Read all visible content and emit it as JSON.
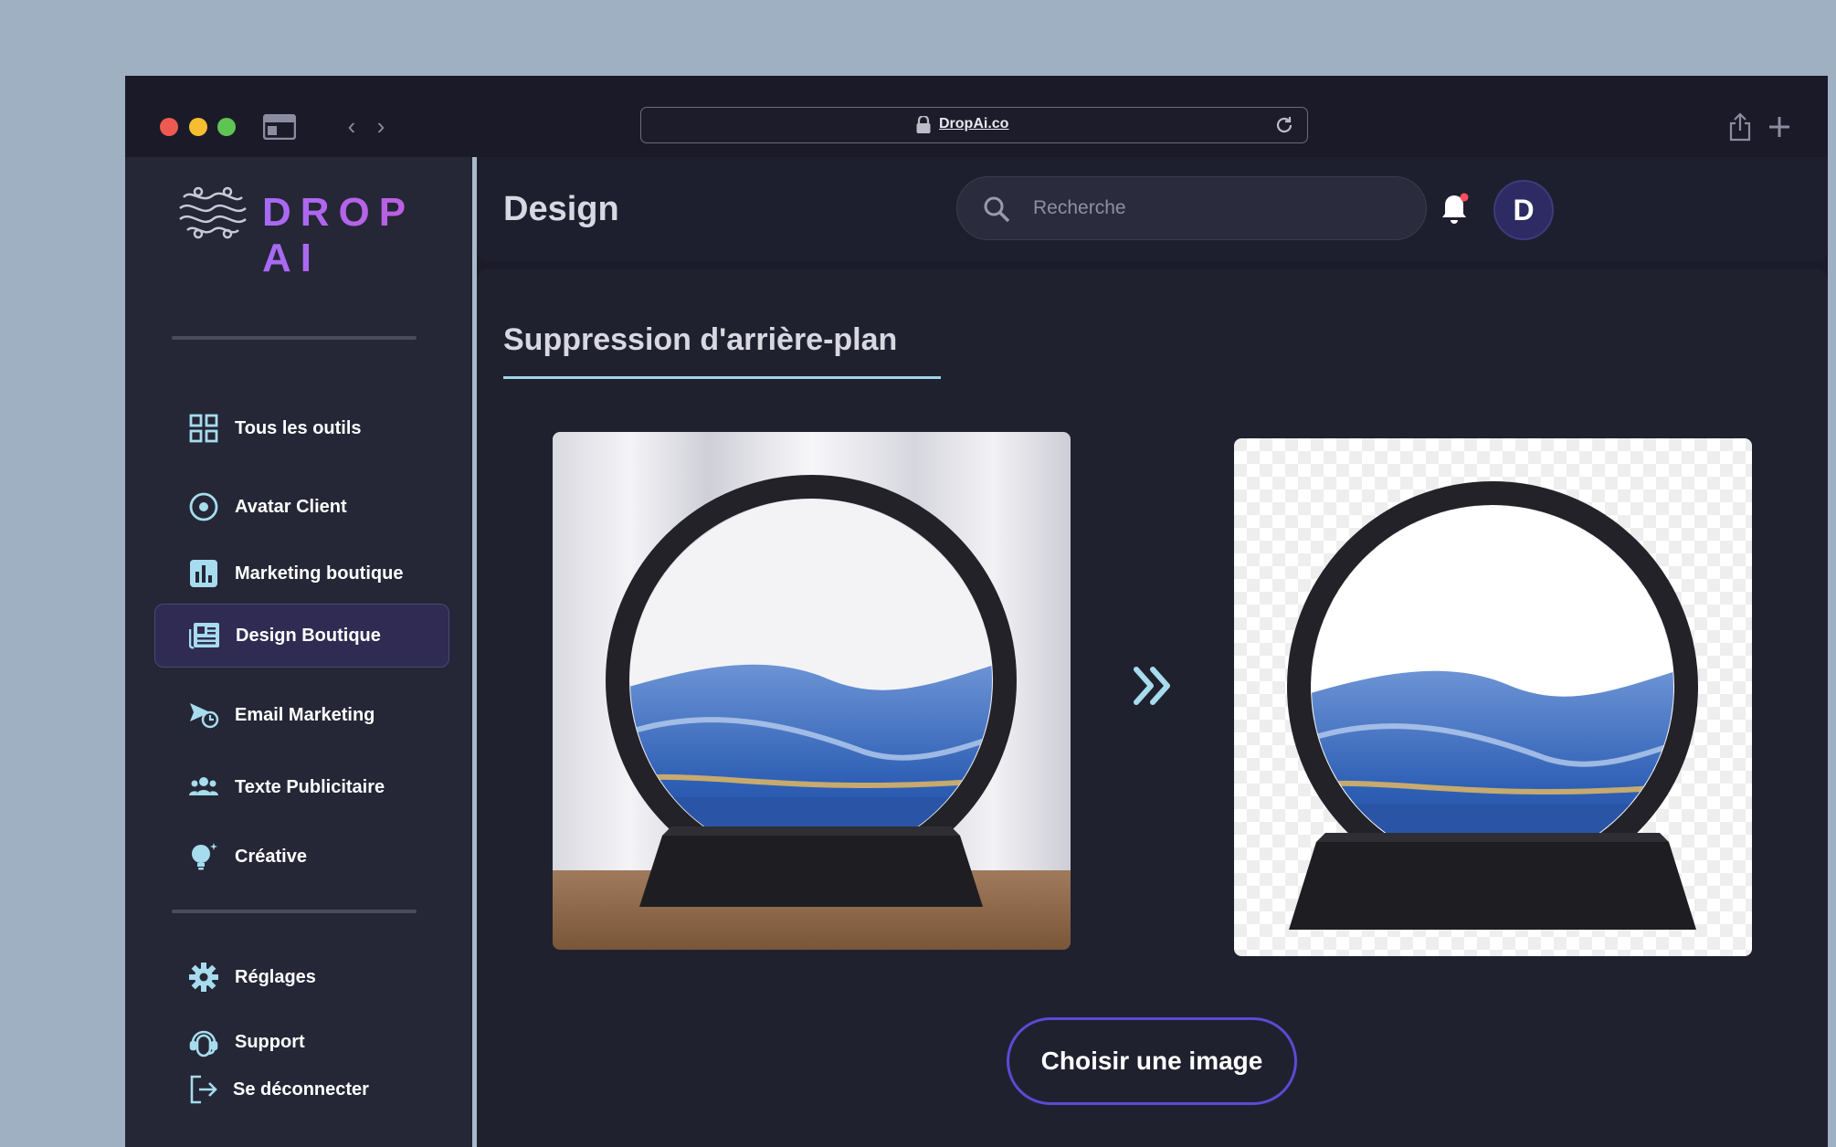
{
  "browser": {
    "url": "DropAi.co"
  },
  "sidebar": {
    "logo_text": "DROP AI",
    "items": [
      {
        "label": "Tous les outils",
        "icon": "grid-icon"
      },
      {
        "label": "Avatar Client",
        "icon": "target-icon"
      },
      {
        "label": "Marketing boutique",
        "icon": "bar-chart-icon"
      },
      {
        "label": "Design Boutique",
        "icon": "newspaper-icon",
        "active": true
      },
      {
        "label": "Email Marketing",
        "icon": "send-clock-icon"
      },
      {
        "label": "Texte Publicitaire",
        "icon": "people-icon"
      },
      {
        "label": "Créative",
        "icon": "lightbulb-icon"
      }
    ],
    "bottom_items": [
      {
        "label": "Réglages",
        "icon": "gear-icon"
      },
      {
        "label": "Support",
        "icon": "support-agent-icon"
      },
      {
        "label": "Se déconnecter",
        "icon": "logout-icon"
      }
    ]
  },
  "header": {
    "title": "Design",
    "search_placeholder": "Recherche",
    "avatar_initial": "D"
  },
  "main": {
    "section_title": "Suppression d'arrière-plan",
    "choose_button": "Choisir une image"
  },
  "colors": {
    "accent": "#9fd5e8",
    "brand_purple": "#b45bf2",
    "button_border": "#5b4ad6",
    "notification_dot": "#ff4d5e"
  }
}
